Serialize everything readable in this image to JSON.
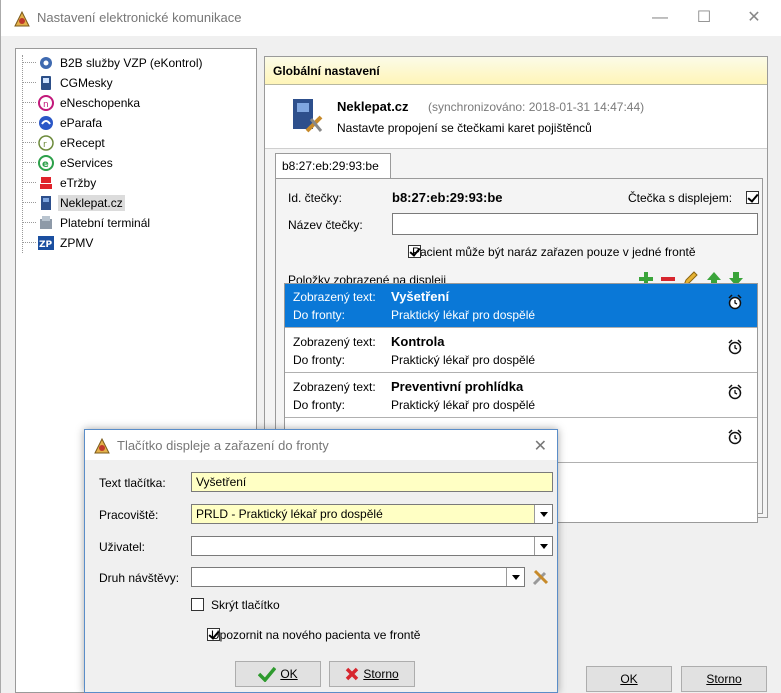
{
  "window": {
    "title": "Nastavení elektronické komunikace",
    "minimize": "—",
    "maximize": "☐",
    "close": "✕",
    "ok": "OK",
    "storno": "Storno"
  },
  "tree": {
    "items": [
      {
        "label": "B2B služby VZP (eKontrol)",
        "icon": "gear-icon"
      },
      {
        "label": "CGMesky",
        "icon": "device-icon"
      },
      {
        "label": "eNeschopenka",
        "icon": "pink-circle-icon"
      },
      {
        "label": "eParafa",
        "icon": "blue-badge-icon"
      },
      {
        "label": "eRecept",
        "icon": "recipe-icon"
      },
      {
        "label": "eServices",
        "icon": "green-e-icon"
      },
      {
        "label": "eTržby",
        "icon": "red-register-icon"
      },
      {
        "label": "Neklepat.cz",
        "icon": "card-reader-icon"
      },
      {
        "label": "Platební terminál",
        "icon": "terminal-icon"
      },
      {
        "label": "ZPMV",
        "icon": "zp-icon"
      }
    ],
    "selected_index": 7
  },
  "panel": {
    "header_title": "Globální nastavení",
    "service_name": "Neklepat.cz",
    "service_sync": "(synchronizováno: 2018-01-31 14:47:44)",
    "service_desc": "Nastavte propojení se čtečkami karet pojištěnců",
    "tab_label": "b8:27:eb:29:93:be",
    "reader_id_label": "Id. čtečky:",
    "reader_id_value": "b8:27:eb:29:93:be",
    "display_label": "Čtečka s displejem:",
    "reader_name_label": "Název čtečky:",
    "reader_name_value": "",
    "single_queue_label": "Pacient může být naráz zařazen pouze v jedné frontě",
    "items_label": "Položky zobrazené na displeji"
  },
  "items": [
    {
      "k1": "Zobrazený text:",
      "v1": "Vyšetření",
      "k2": "Do fronty:",
      "v2": "Praktický lékař pro dospělé"
    },
    {
      "k1": "Zobrazený text:",
      "v1": "Kontrola",
      "k2": "Do fronty:",
      "v2": "Praktický lékař pro dospělé"
    },
    {
      "k1": "Zobrazený text:",
      "v1": "Preventivní prohlídka",
      "k2": "Do fronty:",
      "v2": "Praktický lékař pro dospělé"
    },
    {
      "k1": "",
      "v1": "",
      "k2": "",
      "v2": ""
    }
  ],
  "dialog": {
    "title": "Tlačítko displeje a zařazení do fronty",
    "close": "✕",
    "text_label": "Text tlačítka:",
    "text_value": "Vyšetření",
    "workplace_label": "Pracoviště:",
    "workplace_value": "PRLD - Praktický lékař pro dospělé",
    "user_label": "Uživatel:",
    "user_value": "",
    "visit_label": "Druh návštěvy:",
    "visit_value": "",
    "hide_label": "Skrýt tlačítko",
    "notify_label": "Upozornit na nového pacienta ve frontě",
    "ok_label": "OK",
    "storno_label": "Storno"
  }
}
